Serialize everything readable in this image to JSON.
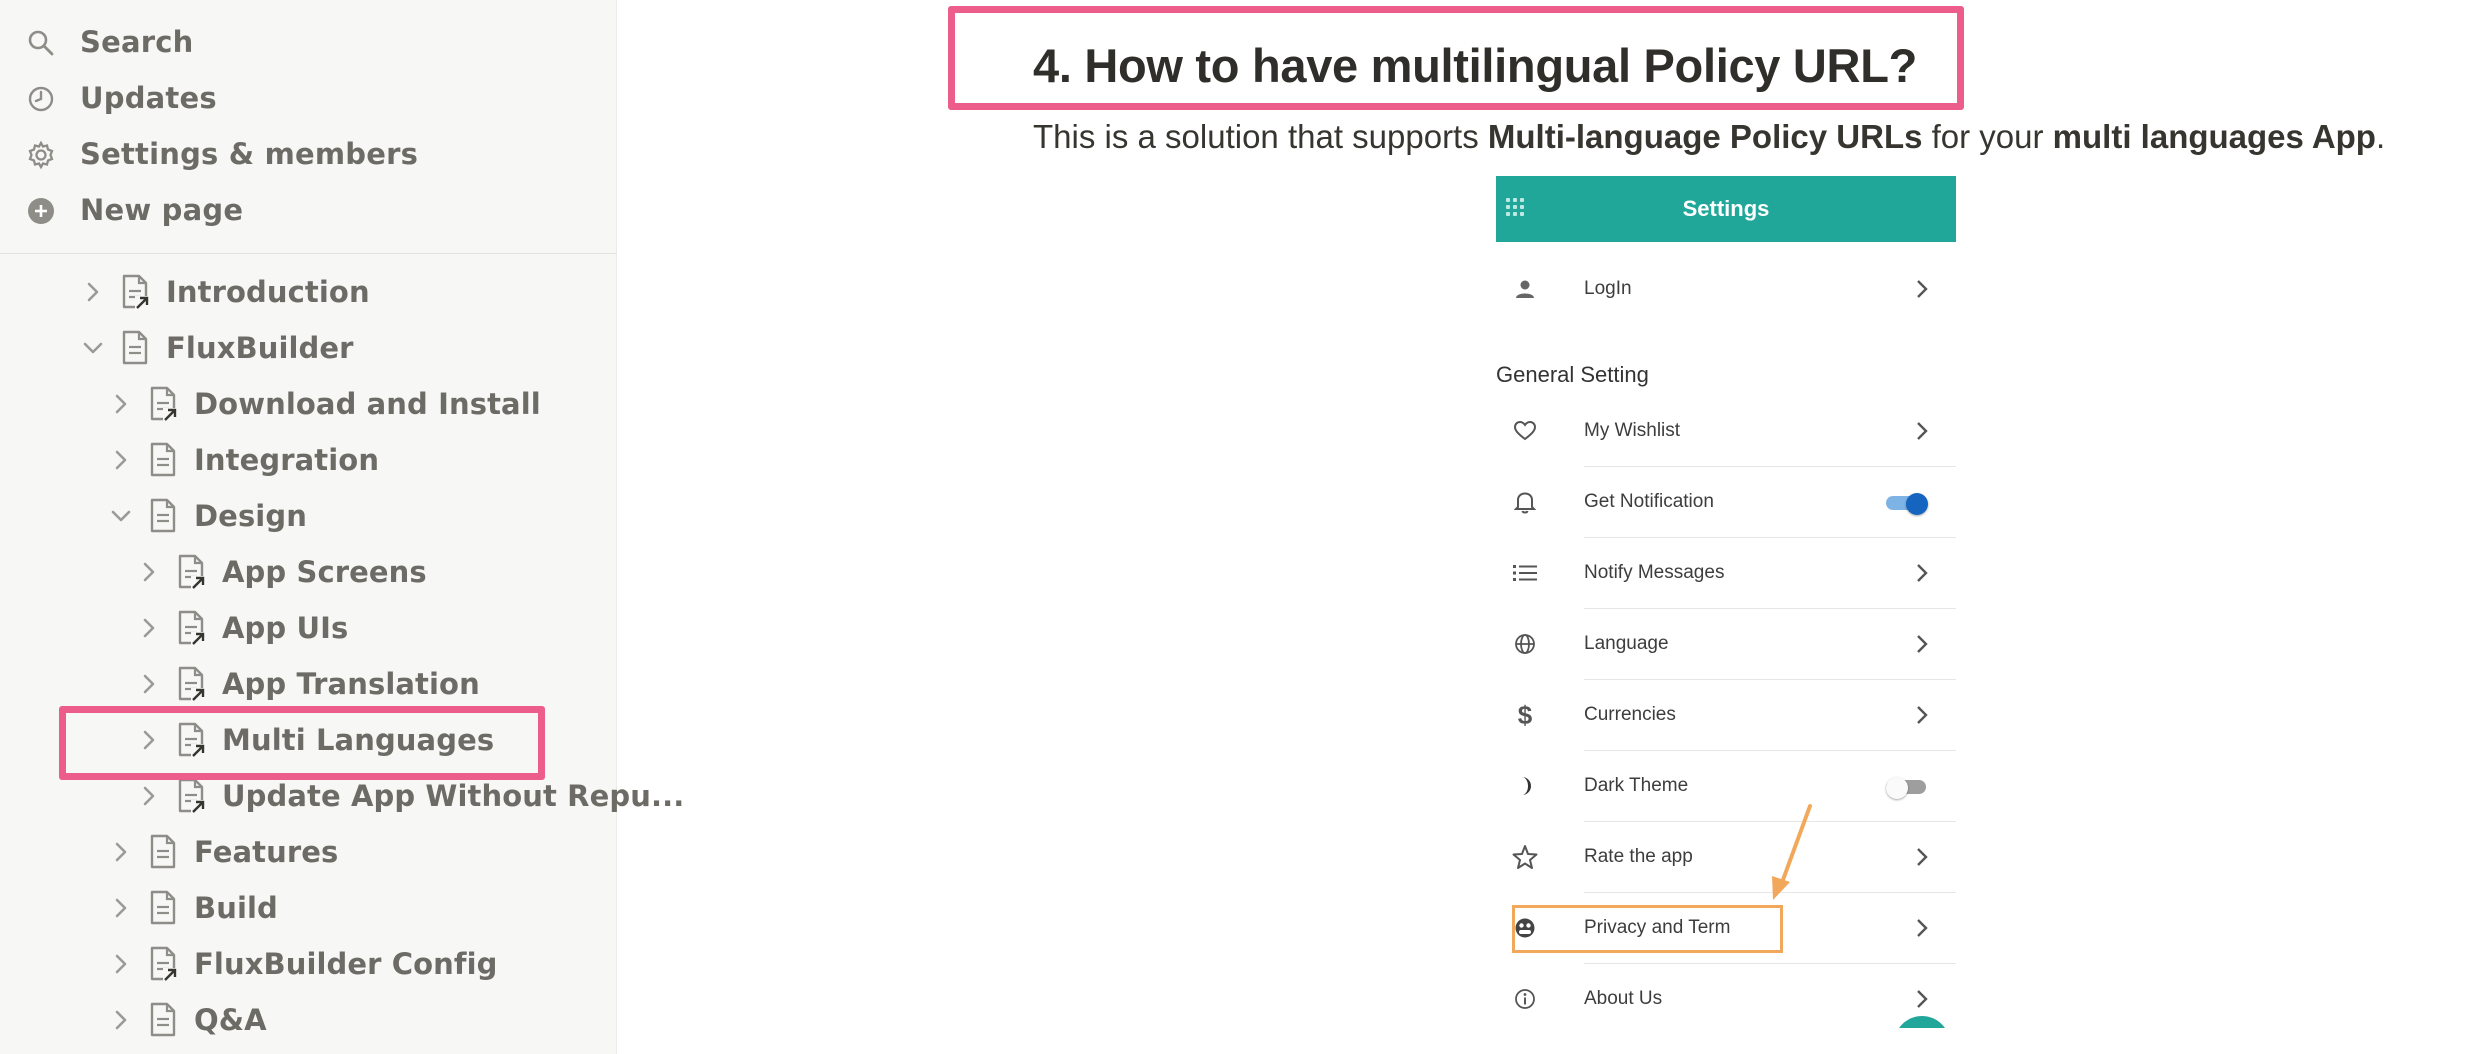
{
  "sidebar": {
    "quick_actions": [
      {
        "label": "Search",
        "icon": "search-icon"
      },
      {
        "label": "Updates",
        "icon": "clock-icon"
      },
      {
        "label": "Settings & members",
        "icon": "gear-icon"
      },
      {
        "label": "New page",
        "icon": "plus-circle-icon"
      }
    ],
    "tree": [
      {
        "label": "Introduction",
        "expanded": false,
        "linked": true
      },
      {
        "label": "FluxBuilder",
        "expanded": true,
        "linked": false
      },
      {
        "label": "Download and Install",
        "expanded": false,
        "linked": true
      },
      {
        "label": "Integration",
        "expanded": false,
        "linked": false
      },
      {
        "label": "Design",
        "expanded": true,
        "linked": false
      },
      {
        "label": "App Screens",
        "expanded": false,
        "linked": true
      },
      {
        "label": "App UIs",
        "expanded": false,
        "linked": true
      },
      {
        "label": "App Translation",
        "expanded": false,
        "linked": true
      },
      {
        "label": "Multi Languages",
        "expanded": false,
        "linked": true,
        "highlighted": true
      },
      {
        "label": "Update App Without Repu...",
        "expanded": false,
        "linked": true
      },
      {
        "label": "Features",
        "expanded": false,
        "linked": false
      },
      {
        "label": "Build",
        "expanded": false,
        "linked": false
      },
      {
        "label": "FluxBuilder Config",
        "expanded": false,
        "linked": true
      },
      {
        "label": "Q&A",
        "expanded": false,
        "linked": false
      }
    ]
  },
  "content": {
    "heading": "4. How to have multilingual Policy URL?",
    "intro_1": "This is a solution that supports ",
    "intro_bold_1": "Multi-language Policy URLs",
    "intro_2": " for your ",
    "intro_bold_2": "multi languages App",
    "intro_3": "."
  },
  "phone": {
    "header_title": "Settings",
    "login_label": "LogIn",
    "section_title": "General Setting",
    "items": [
      {
        "label": "My Wishlist",
        "icon": "heart-icon",
        "control": "arrow"
      },
      {
        "label": "Get Notification",
        "icon": "bell-icon",
        "control": "toggle",
        "on": true
      },
      {
        "label": "Notify Messages",
        "icon": "list-icon",
        "control": "arrow"
      },
      {
        "label": "Language",
        "icon": "globe-icon",
        "control": "arrow"
      },
      {
        "label": "Currencies",
        "icon": "dollar-icon",
        "control": "arrow"
      },
      {
        "label": "Dark Theme",
        "icon": "moon-icon",
        "control": "toggle",
        "on": false
      },
      {
        "label": "Rate the app",
        "icon": "star-icon",
        "control": "arrow"
      },
      {
        "label": "Privacy and Term",
        "icon": "privacy-icon",
        "control": "arrow"
      },
      {
        "label": "About Us",
        "icon": "info-icon",
        "control": "arrow"
      }
    ]
  },
  "colors": {
    "highlight": "#ec5d8c",
    "teal": "#21a79a",
    "callout": "#f2a85b",
    "toggle_on": "#1565c0"
  }
}
